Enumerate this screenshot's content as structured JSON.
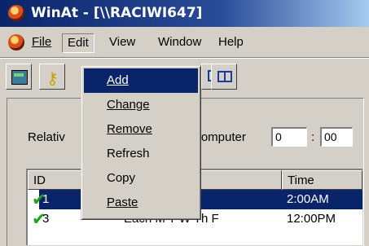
{
  "window": {
    "title": "WinAt - [\\\\RACIWI647]",
    "icon": "winat-app-icon"
  },
  "menubar": {
    "items": [
      "File",
      "Edit",
      "View",
      "Window",
      "Help"
    ],
    "active": "Edit"
  },
  "edit_menu": {
    "items": [
      "Add",
      "Change",
      "Remove",
      "Refresh",
      "Copy",
      "Paste"
    ],
    "highlighted": "Add"
  },
  "toolbar": {
    "buttons": [
      "add-job-icon",
      "key-icon",
      "grid-view-icon",
      "split-view-icon"
    ]
  },
  "panel": {
    "relative_label": "Relativ",
    "computer_label": "Computer",
    "hours_value": "0",
    "minutes_value": "00",
    "separator": ":"
  },
  "list": {
    "columns": [
      "ID",
      "Time"
    ],
    "rows": [
      {
        "id": "1",
        "days": "",
        "time": "2:00AM",
        "selected": true
      },
      {
        "id": "3",
        "days": "Each M T W Th F",
        "time": "12:00PM",
        "selected": false
      }
    ]
  },
  "colors": {
    "titlebar": "#0a246a",
    "selection": "#0a246a",
    "face": "#d4d0c8",
    "check": "#20a020"
  }
}
